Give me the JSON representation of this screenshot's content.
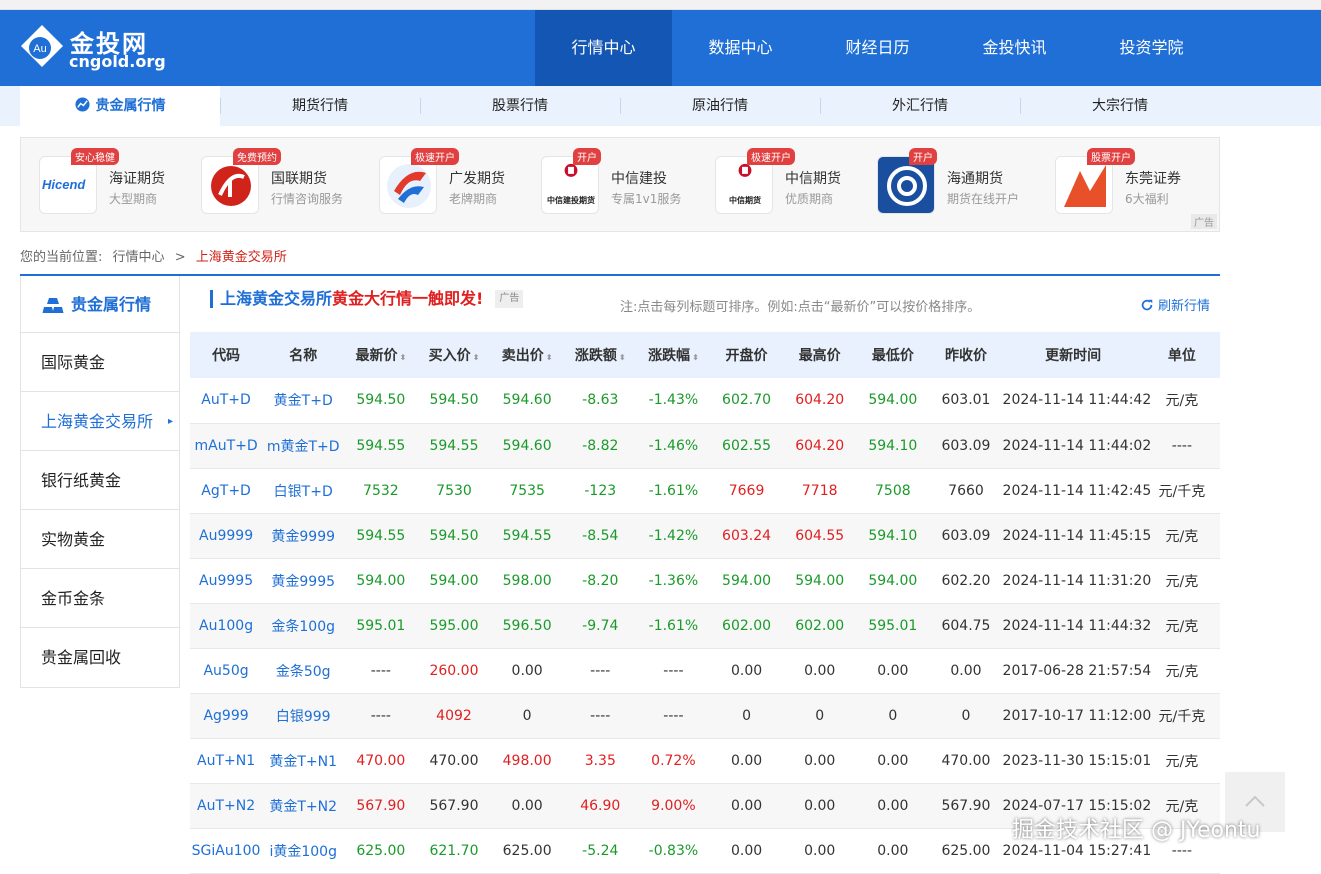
{
  "header": {
    "logo_cn": "金投网",
    "logo_en": "cngold.org",
    "logo_mark": "Au",
    "nav": [
      "行情中心",
      "数据中心",
      "财经日历",
      "金投快讯",
      "投资学院"
    ],
    "active_nav": "行情中心"
  },
  "subnav": [
    "贵金属行情",
    "期货行情",
    "股票行情",
    "原油行情",
    "外汇行情",
    "大宗行情"
  ],
  "ads": [
    {
      "badge": "安心稳健",
      "name": "海证期货",
      "sub": "大型期商",
      "logo_text": "Hicend",
      "color": "#1f6fd6"
    },
    {
      "badge": "免费预约",
      "name": "国联期货",
      "sub": "行情咨询服务",
      "logo_text": "",
      "color": "#d0231a"
    },
    {
      "badge": "极速开户",
      "name": "广发期货",
      "sub": "老牌期商",
      "logo_text": "",
      "color": "#1f6fd6"
    },
    {
      "badge": "开户",
      "name": "中信建投",
      "sub": "专属1v1服务",
      "logo_text": "中信建投期货",
      "color": "#c8102e"
    },
    {
      "badge": "极速开户",
      "name": "中信期货",
      "sub": "优质期商",
      "logo_text": "中信期货",
      "color": "#c8102e"
    },
    {
      "badge": "开户",
      "name": "海通期货",
      "sub": "期货在线开户",
      "logo_text": "",
      "color": "#1a4fa0"
    },
    {
      "badge": "股票开户",
      "name": "东莞证券",
      "sub": "6大福利",
      "logo_text": "",
      "color": "#e8502a"
    }
  ],
  "ad_tag": "广告",
  "breadcrumb": {
    "label": "您的当前位置:",
    "parent": "行情中心",
    "sep": ">",
    "current": "上海黄金交易所"
  },
  "sidebar": {
    "title": "贵金属行情",
    "items": [
      "国际黄金",
      "上海黄金交易所",
      "银行纸黄金",
      "实物黄金",
      "金币金条",
      "贵金属回收"
    ],
    "active": "上海黄金交易所"
  },
  "panel": {
    "title": "上海黄金交易所",
    "promo": "黄金大行情一触即发!",
    "ad_tag": "广告",
    "note": "注:点击每列标题可排序。例如:点击“最新价”可以按价格排序。",
    "refresh": "刷新行情"
  },
  "table": {
    "headers": [
      "代码",
      "名称",
      "最新价",
      "买入价",
      "卖出价",
      "涨跌额",
      "涨跌幅",
      "开盘价",
      "最高价",
      "最低价",
      "昨收价",
      "更新时间",
      "单位"
    ],
    "sortable": [
      false,
      false,
      true,
      true,
      true,
      true,
      true,
      false,
      false,
      false,
      false,
      false,
      false
    ],
    "rows": [
      {
        "cells": [
          "AuT+D",
          "黄金T+D",
          "594.50",
          "594.50",
          "594.60",
          "-8.63",
          "-1.43%",
          "602.70",
          "604.20",
          "594.00",
          "603.01",
          "2024-11-14 11:44:42",
          "元/克"
        ],
        "dirs": [
          "",
          "",
          "down",
          "down",
          "down",
          "down",
          "down",
          "down",
          "up",
          "down",
          "flat",
          "flat",
          "flat"
        ]
      },
      {
        "cells": [
          "mAuT+D",
          "m黄金T+D",
          "594.55",
          "594.55",
          "594.60",
          "-8.82",
          "-1.46%",
          "602.55",
          "604.20",
          "594.10",
          "603.09",
          "2024-11-14 11:44:02",
          "----"
        ],
        "dirs": [
          "",
          "",
          "down",
          "down",
          "down",
          "down",
          "down",
          "down",
          "up",
          "down",
          "flat",
          "flat",
          "flat"
        ]
      },
      {
        "cells": [
          "AgT+D",
          "白银T+D",
          "7532",
          "7530",
          "7535",
          "-123",
          "-1.61%",
          "7669",
          "7718",
          "7508",
          "7660",
          "2024-11-14 11:42:45",
          "元/千克"
        ],
        "dirs": [
          "",
          "",
          "down",
          "down",
          "down",
          "down",
          "down",
          "up",
          "up",
          "down",
          "flat",
          "flat",
          "flat"
        ]
      },
      {
        "cells": [
          "Au9999",
          "黄金9999",
          "594.55",
          "594.50",
          "594.55",
          "-8.54",
          "-1.42%",
          "603.24",
          "604.55",
          "594.10",
          "603.09",
          "2024-11-14 11:45:15",
          "元/克"
        ],
        "dirs": [
          "",
          "",
          "down",
          "down",
          "down",
          "down",
          "down",
          "up",
          "up",
          "down",
          "flat",
          "flat",
          "flat"
        ]
      },
      {
        "cells": [
          "Au9995",
          "黄金9995",
          "594.00",
          "594.00",
          "598.00",
          "-8.20",
          "-1.36%",
          "594.00",
          "594.00",
          "594.00",
          "602.20",
          "2024-11-14 11:31:20",
          "元/克"
        ],
        "dirs": [
          "",
          "",
          "down",
          "down",
          "down",
          "down",
          "down",
          "down",
          "down",
          "down",
          "flat",
          "flat",
          "flat"
        ]
      },
      {
        "cells": [
          "Au100g",
          "金条100g",
          "595.01",
          "595.00",
          "596.50",
          "-9.74",
          "-1.61%",
          "602.00",
          "602.00",
          "595.01",
          "604.75",
          "2024-11-14 11:44:32",
          "元/克"
        ],
        "dirs": [
          "",
          "",
          "down",
          "down",
          "down",
          "down",
          "down",
          "down",
          "down",
          "down",
          "flat",
          "flat",
          "flat"
        ]
      },
      {
        "cells": [
          "Au50g",
          "金条50g",
          "----",
          "260.00",
          "0.00",
          "----",
          "----",
          "0.00",
          "0.00",
          "0.00",
          "0.00",
          "2017-06-28 21:57:54",
          "元/克"
        ],
        "dirs": [
          "",
          "",
          "flat",
          "up",
          "flat",
          "flat",
          "flat",
          "flat",
          "flat",
          "flat",
          "flat",
          "flat",
          "flat"
        ]
      },
      {
        "cells": [
          "Ag999",
          "白银999",
          "----",
          "4092",
          "0",
          "----",
          "----",
          "0",
          "0",
          "0",
          "0",
          "2017-10-17 11:12:00",
          "元/千克"
        ],
        "dirs": [
          "",
          "",
          "flat",
          "up",
          "flat",
          "flat",
          "flat",
          "flat",
          "flat",
          "flat",
          "flat",
          "flat",
          "flat"
        ]
      },
      {
        "cells": [
          "AuT+N1",
          "黄金T+N1",
          "470.00",
          "470.00",
          "498.00",
          "3.35",
          "0.72%",
          "0.00",
          "0.00",
          "0.00",
          "470.00",
          "2023-11-30 15:15:01",
          "元/克"
        ],
        "dirs": [
          "",
          "",
          "up",
          "flat",
          "up",
          "up",
          "up",
          "flat",
          "flat",
          "flat",
          "flat",
          "flat",
          "flat"
        ]
      },
      {
        "cells": [
          "AuT+N2",
          "黄金T+N2",
          "567.90",
          "567.90",
          "0.00",
          "46.90",
          "9.00%",
          "0.00",
          "0.00",
          "0.00",
          "567.90",
          "2024-07-17 15:15:02",
          "元/克"
        ],
        "dirs": [
          "",
          "",
          "up",
          "flat",
          "flat",
          "up",
          "up",
          "flat",
          "flat",
          "flat",
          "flat",
          "flat",
          "flat"
        ]
      },
      {
        "cells": [
          "SGiAu100",
          "i黄金100g",
          "625.00",
          "621.70",
          "625.00",
          "-5.24",
          "-0.83%",
          "0.00",
          "0.00",
          "0.00",
          "625.00",
          "2024-11-04 15:27:41",
          "----"
        ],
        "dirs": [
          "",
          "",
          "down",
          "down",
          "flat",
          "down",
          "down",
          "flat",
          "flat",
          "flat",
          "flat",
          "flat",
          "flat"
        ]
      }
    ]
  },
  "watermark": "掘金技术社区 @ JYeontu",
  "colors": {
    "brand": "#1f6fd6",
    "up": "#e02020",
    "down": "#1a9a2a"
  }
}
